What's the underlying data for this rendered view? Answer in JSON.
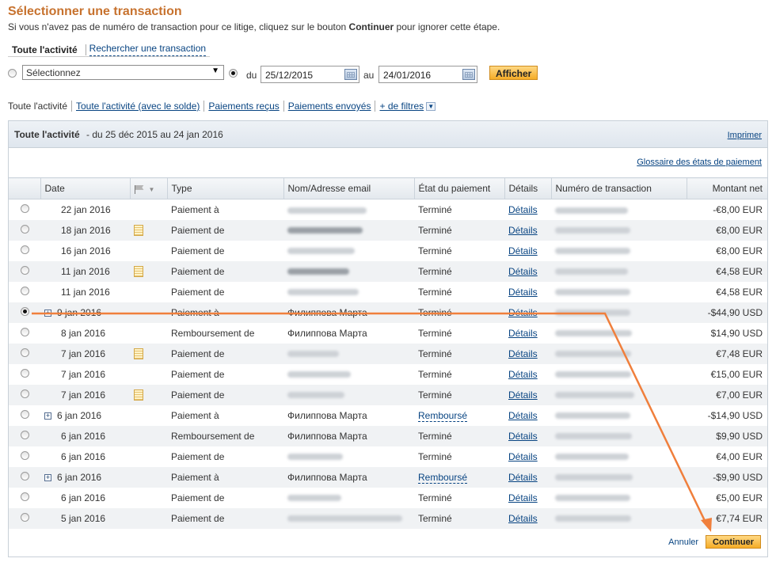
{
  "title": "Sélectionner une transaction",
  "subtitle_pre": "Si vous n'avez pas de numéro de transaction pour ce litige, cliquez sur le bouton ",
  "subtitle_bold": "Continuer",
  "subtitle_post": " pour ignorer cette étape.",
  "top_tabs": {
    "active": "Toute l'activité",
    "search": "Rechercher une transaction"
  },
  "filter": {
    "select_value": "Sélectionnez",
    "du_label": "du",
    "date_from": "25/12/2015",
    "au_label": "au",
    "date_to": "24/01/2016",
    "show_button": "Afficher"
  },
  "sub_tabs": {
    "active": "Toute l'activité",
    "balance": "Toute l'activité (avec le solde)",
    "received": "Paiements reçus",
    "sent": "Paiements envoyés",
    "more": "+ de filtres"
  },
  "panel": {
    "title": "Toute l'activité",
    "range": "- du 25 déc 2015 au 24 jan 2016",
    "print": "Imprimer",
    "glossary": "Glossaire des états de paiement"
  },
  "table": {
    "headers": {
      "date": "Date",
      "type": "Type",
      "name": "Nom/Adresse email",
      "state": "État du paiement",
      "details": "Détails",
      "txn": "Numéro de transaction",
      "amount": "Montant net"
    },
    "rows": [
      {
        "date": "22 jan 2016",
        "type": "Paiement à",
        "name": "",
        "state": "Terminé",
        "details": "Détails",
        "amount": "-€8,00 EUR"
      },
      {
        "date": "18 jan 2016",
        "type": "Paiement de",
        "name": "",
        "state": "Terminé",
        "details": "Détails",
        "amount": "€8,00 EUR"
      },
      {
        "date": "16 jan 2016",
        "type": "Paiement de",
        "name": "",
        "state": "Terminé",
        "details": "Détails",
        "amount": "€8,00 EUR"
      },
      {
        "date": "11 jan 2016",
        "type": "Paiement de",
        "name": "",
        "state": "Terminé",
        "details": "Détails",
        "amount": "€4,58 EUR"
      },
      {
        "date": "11 jan 2016",
        "type": "Paiement de",
        "name": "",
        "state": "Terminé",
        "details": "Détails",
        "amount": "€4,58 EUR"
      },
      {
        "date": "9 jan 2016",
        "type": "Paiement à",
        "name": "Филиппова Марта",
        "state": "Terminé",
        "details": "Détails",
        "amount": "-$44,90 USD"
      },
      {
        "date": "8 jan 2016",
        "type": "Remboursement de",
        "name": "Филиппова Марта",
        "state": "Terminé",
        "details": "Détails",
        "amount": "$14,90 USD"
      },
      {
        "date": "7 jan 2016",
        "type": "Paiement de",
        "name": "",
        "state": "Terminé",
        "details": "Détails",
        "amount": "€7,48 EUR"
      },
      {
        "date": "7 jan 2016",
        "type": "Paiement de",
        "name": "",
        "state": "Terminé",
        "details": "Détails",
        "amount": "€15,00 EUR"
      },
      {
        "date": "7 jan 2016",
        "type": "Paiement de",
        "name": "",
        "state": "Terminé",
        "details": "Détails",
        "amount": "€7,00 EUR"
      },
      {
        "date": "6 jan 2016",
        "type": "Paiement à",
        "name": "Филиппова Марта",
        "state": "Remboursé",
        "details": "Détails",
        "amount": "-$14,90 USD"
      },
      {
        "date": "6 jan 2016",
        "type": "Remboursement de",
        "name": "Филиппова Марта",
        "state": "Terminé",
        "details": "Détails",
        "amount": "$9,90 USD"
      },
      {
        "date": "6 jan 2016",
        "type": "Paiement de",
        "name": "",
        "state": "Terminé",
        "details": "Détails",
        "amount": "€4,00 EUR"
      },
      {
        "date": "6 jan 2016",
        "type": "Paiement à",
        "name": "Филиппова Марта",
        "state": "Remboursé",
        "details": "Détails",
        "amount": "-$9,90 USD"
      },
      {
        "date": "6 jan 2016",
        "type": "Paiement de",
        "name": "",
        "state": "Terminé",
        "details": "Détails",
        "amount": "€5,00 EUR"
      },
      {
        "date": "5 jan 2016",
        "type": "Paiement de",
        "name": "",
        "state": "Terminé",
        "details": "Détails",
        "amount": "€7,74 EUR"
      }
    ]
  },
  "footer": {
    "cancel": "Annuler",
    "continue": "Continuer"
  },
  "colors": {
    "title": "#c7722e",
    "link": "#084482",
    "annotation": "#f07f3c"
  }
}
